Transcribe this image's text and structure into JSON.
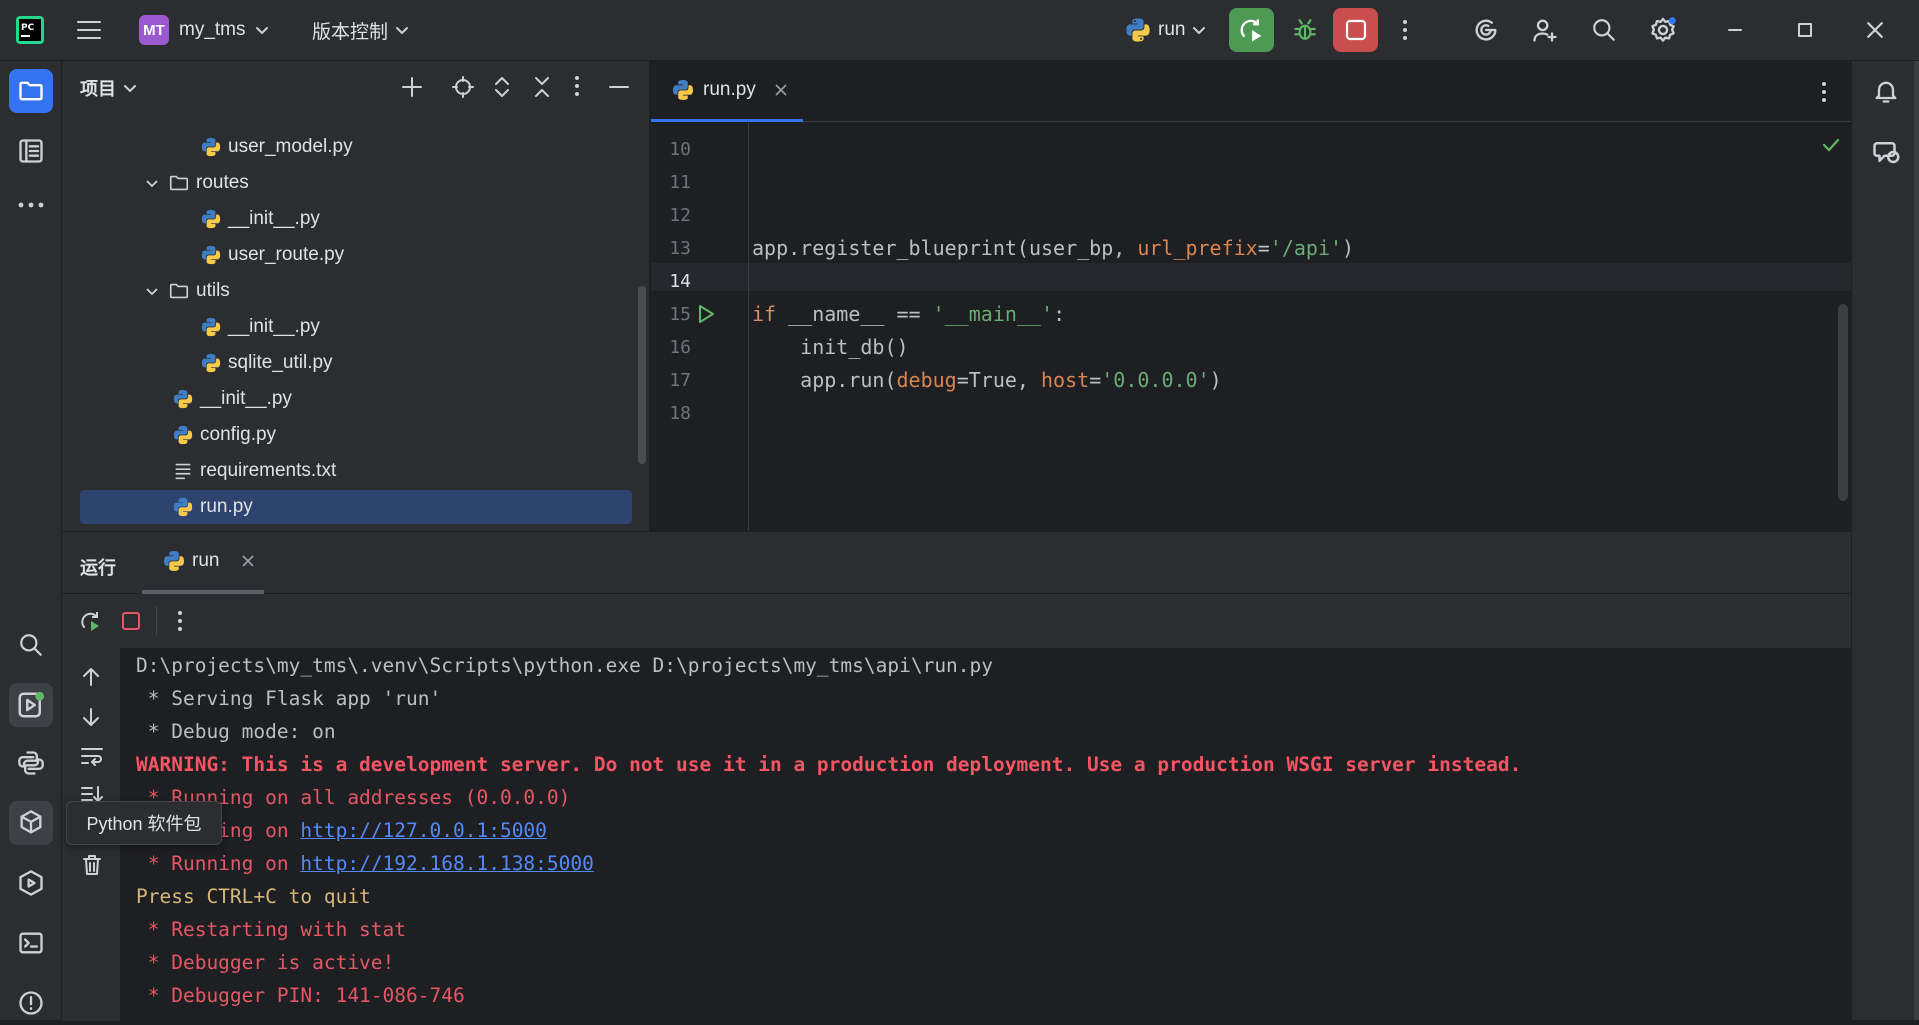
{
  "titlebar": {
    "project_badge": "MT",
    "project_name": "my_tms",
    "vcs_label": "版本控制",
    "run_config": "run"
  },
  "project_panel": {
    "title": "项目",
    "tree": [
      {
        "name": "user_model.py",
        "type": "py",
        "indent": 2
      },
      {
        "name": "routes",
        "type": "folder",
        "indent": 1
      },
      {
        "name": "__init__.py",
        "type": "py",
        "indent": 2
      },
      {
        "name": "user_route.py",
        "type": "py",
        "indent": 2
      },
      {
        "name": "utils",
        "type": "folder",
        "indent": 1
      },
      {
        "name": "__init__.py",
        "type": "py",
        "indent": 2
      },
      {
        "name": "sqlite_util.py",
        "type": "py",
        "indent": 2
      },
      {
        "name": "__init__.py",
        "type": "py",
        "indent": 1
      },
      {
        "name": "config.py",
        "type": "py",
        "indent": 1
      },
      {
        "name": "requirements.txt",
        "type": "txt",
        "indent": 1
      },
      {
        "name": "run.py",
        "type": "py",
        "indent": 1,
        "selected": true
      }
    ]
  },
  "editor": {
    "tab_label": "run.py",
    "line_numbers": [
      "10",
      "11",
      "12",
      "13",
      "14",
      "15",
      "16",
      "17",
      "18"
    ],
    "code": {
      "l13_a": "app.register_blueprint(user_bp, ",
      "l13_kw": "url_prefix",
      "l13_eq": "=",
      "l13_str": "'/api'",
      "l13_end": ")",
      "l15_kw": "if",
      "l15_a": " __name__ == ",
      "l15_str": "'__main__'",
      "l15_end": ":",
      "l16": "    init_db()",
      "l17_a": "    app.run(",
      "l17_kw1": "debug",
      "l17_b": "=True, ",
      "l17_kw2": "host",
      "l17_eq": "=",
      "l17_str": "'0.0.0.0'",
      "l17_end": ")"
    }
  },
  "run_panel": {
    "title": "运行",
    "tab_label": "run",
    "tooltip": "Python 软件包",
    "console": {
      "l1": "D:\\projects\\my_tms\\.venv\\Scripts\\python.exe D:\\projects\\my_tms\\api\\run.py",
      "l2": " * Serving Flask app 'run'",
      "l3": " * Debug mode: on",
      "l4": "WARNING: This is a development server. Do not use it in a production deployment. Use a production WSGI server instead.",
      "l5": " * Running on all addresses (0.0.0.0)",
      "l6_prefix": " * Running on ",
      "l6_link": "http://127.0.0.1:5000",
      "l7_prefix": " * Running on ",
      "l7_link": "http://192.168.1.138:5000",
      "l8": "Press CTRL+C to quit",
      "l9": " * Restarting with stat",
      "l10": " * Debugger is active!",
      "l11": " * Debugger PIN: 141-086-746"
    }
  },
  "colors": {
    "accent": "#3574f0",
    "run_green": "#4e9a55",
    "stop_red": "#c94f4f",
    "error_red": "#e55765",
    "warn_red": "#f75464",
    "yellow": "#d5b778",
    "link": "#548af7",
    "string": "#6aab73",
    "keyword": "#cf8e6d",
    "param": "#d9854f"
  }
}
